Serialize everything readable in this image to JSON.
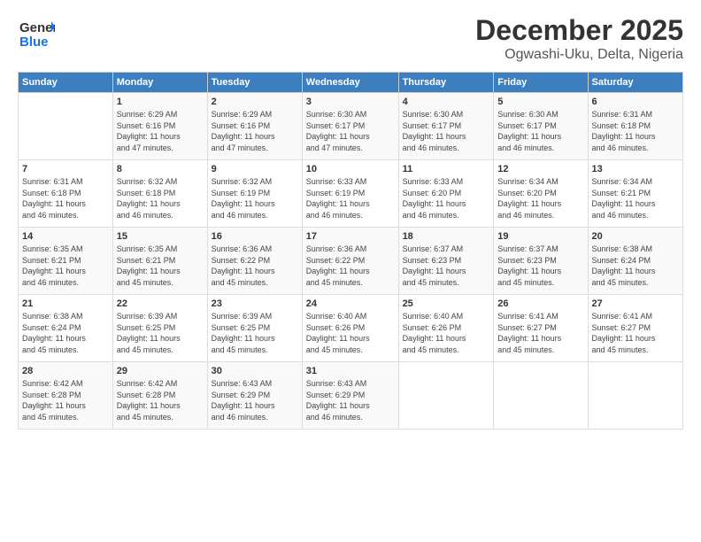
{
  "header": {
    "logo_line1": "General",
    "logo_line2": "Blue",
    "title": "December 2025",
    "subtitle": "Ogwashi-Uku, Delta, Nigeria"
  },
  "days_of_week": [
    "Sunday",
    "Monday",
    "Tuesday",
    "Wednesday",
    "Thursday",
    "Friday",
    "Saturday"
  ],
  "weeks": [
    [
      {
        "day": "",
        "info": ""
      },
      {
        "day": "1",
        "info": "Sunrise: 6:29 AM\nSunset: 6:16 PM\nDaylight: 11 hours\nand 47 minutes."
      },
      {
        "day": "2",
        "info": "Sunrise: 6:29 AM\nSunset: 6:16 PM\nDaylight: 11 hours\nand 47 minutes."
      },
      {
        "day": "3",
        "info": "Sunrise: 6:30 AM\nSunset: 6:17 PM\nDaylight: 11 hours\nand 47 minutes."
      },
      {
        "day": "4",
        "info": "Sunrise: 6:30 AM\nSunset: 6:17 PM\nDaylight: 11 hours\nand 46 minutes."
      },
      {
        "day": "5",
        "info": "Sunrise: 6:30 AM\nSunset: 6:17 PM\nDaylight: 11 hours\nand 46 minutes."
      },
      {
        "day": "6",
        "info": "Sunrise: 6:31 AM\nSunset: 6:18 PM\nDaylight: 11 hours\nand 46 minutes."
      }
    ],
    [
      {
        "day": "7",
        "info": "Sunrise: 6:31 AM\nSunset: 6:18 PM\nDaylight: 11 hours\nand 46 minutes."
      },
      {
        "day": "8",
        "info": "Sunrise: 6:32 AM\nSunset: 6:18 PM\nDaylight: 11 hours\nand 46 minutes."
      },
      {
        "day": "9",
        "info": "Sunrise: 6:32 AM\nSunset: 6:19 PM\nDaylight: 11 hours\nand 46 minutes."
      },
      {
        "day": "10",
        "info": "Sunrise: 6:33 AM\nSunset: 6:19 PM\nDaylight: 11 hours\nand 46 minutes."
      },
      {
        "day": "11",
        "info": "Sunrise: 6:33 AM\nSunset: 6:20 PM\nDaylight: 11 hours\nand 46 minutes."
      },
      {
        "day": "12",
        "info": "Sunrise: 6:34 AM\nSunset: 6:20 PM\nDaylight: 11 hours\nand 46 minutes."
      },
      {
        "day": "13",
        "info": "Sunrise: 6:34 AM\nSunset: 6:21 PM\nDaylight: 11 hours\nand 46 minutes."
      }
    ],
    [
      {
        "day": "14",
        "info": "Sunrise: 6:35 AM\nSunset: 6:21 PM\nDaylight: 11 hours\nand 46 minutes."
      },
      {
        "day": "15",
        "info": "Sunrise: 6:35 AM\nSunset: 6:21 PM\nDaylight: 11 hours\nand 45 minutes."
      },
      {
        "day": "16",
        "info": "Sunrise: 6:36 AM\nSunset: 6:22 PM\nDaylight: 11 hours\nand 45 minutes."
      },
      {
        "day": "17",
        "info": "Sunrise: 6:36 AM\nSunset: 6:22 PM\nDaylight: 11 hours\nand 45 minutes."
      },
      {
        "day": "18",
        "info": "Sunrise: 6:37 AM\nSunset: 6:23 PM\nDaylight: 11 hours\nand 45 minutes."
      },
      {
        "day": "19",
        "info": "Sunrise: 6:37 AM\nSunset: 6:23 PM\nDaylight: 11 hours\nand 45 minutes."
      },
      {
        "day": "20",
        "info": "Sunrise: 6:38 AM\nSunset: 6:24 PM\nDaylight: 11 hours\nand 45 minutes."
      }
    ],
    [
      {
        "day": "21",
        "info": "Sunrise: 6:38 AM\nSunset: 6:24 PM\nDaylight: 11 hours\nand 45 minutes."
      },
      {
        "day": "22",
        "info": "Sunrise: 6:39 AM\nSunset: 6:25 PM\nDaylight: 11 hours\nand 45 minutes."
      },
      {
        "day": "23",
        "info": "Sunrise: 6:39 AM\nSunset: 6:25 PM\nDaylight: 11 hours\nand 45 minutes."
      },
      {
        "day": "24",
        "info": "Sunrise: 6:40 AM\nSunset: 6:26 PM\nDaylight: 11 hours\nand 45 minutes."
      },
      {
        "day": "25",
        "info": "Sunrise: 6:40 AM\nSunset: 6:26 PM\nDaylight: 11 hours\nand 45 minutes."
      },
      {
        "day": "26",
        "info": "Sunrise: 6:41 AM\nSunset: 6:27 PM\nDaylight: 11 hours\nand 45 minutes."
      },
      {
        "day": "27",
        "info": "Sunrise: 6:41 AM\nSunset: 6:27 PM\nDaylight: 11 hours\nand 45 minutes."
      }
    ],
    [
      {
        "day": "28",
        "info": "Sunrise: 6:42 AM\nSunset: 6:28 PM\nDaylight: 11 hours\nand 45 minutes."
      },
      {
        "day": "29",
        "info": "Sunrise: 6:42 AM\nSunset: 6:28 PM\nDaylight: 11 hours\nand 45 minutes."
      },
      {
        "day": "30",
        "info": "Sunrise: 6:43 AM\nSunset: 6:29 PM\nDaylight: 11 hours\nand 46 minutes."
      },
      {
        "day": "31",
        "info": "Sunrise: 6:43 AM\nSunset: 6:29 PM\nDaylight: 11 hours\nand 46 minutes."
      },
      {
        "day": "",
        "info": ""
      },
      {
        "day": "",
        "info": ""
      },
      {
        "day": "",
        "info": ""
      }
    ]
  ]
}
